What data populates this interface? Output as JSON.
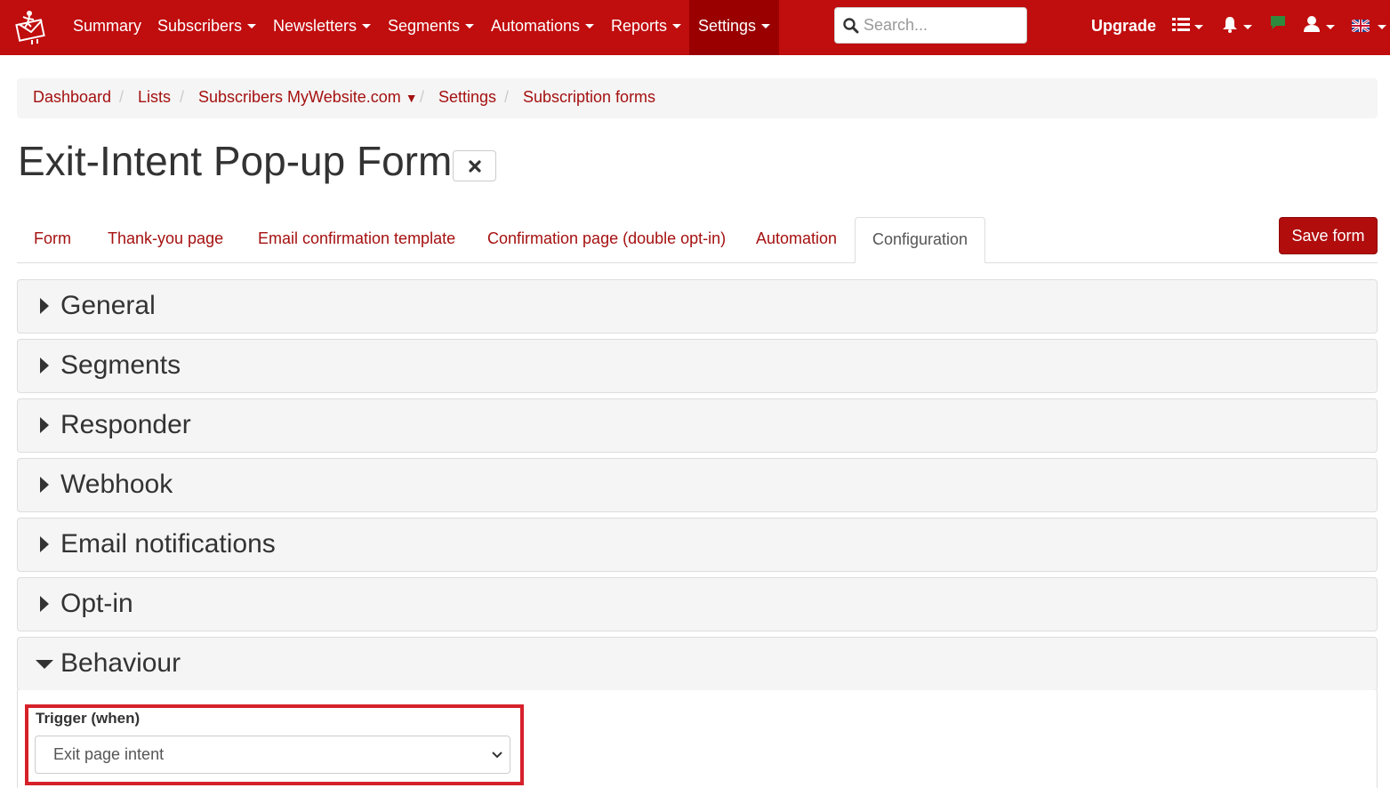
{
  "navbar": {
    "items": [
      {
        "label": "Summary",
        "dropdown": false
      },
      {
        "label": "Subscribers",
        "dropdown": true
      },
      {
        "label": "Newsletters",
        "dropdown": true
      },
      {
        "label": "Segments",
        "dropdown": true
      },
      {
        "label": "Automations",
        "dropdown": true
      },
      {
        "label": "Reports",
        "dropdown": true
      },
      {
        "label": "Settings",
        "dropdown": true,
        "active": true
      }
    ],
    "search_placeholder": "Search...",
    "upgrade_label": "Upgrade",
    "icons": [
      "list-icon",
      "bell-icon",
      "chat-icon",
      "user-icon",
      "uk-flag-icon"
    ],
    "brand_color": "#c00d0e"
  },
  "breadcrumb": {
    "items": [
      "Dashboard",
      "Lists",
      "Subscribers MyWebsite.com",
      "Settings",
      "Subscription forms"
    ],
    "list_dropdown_glyph": "▼"
  },
  "page": {
    "title": "Exit-Intent Pop-up Form"
  },
  "tabs": {
    "items": [
      "Form",
      "Thank-you page",
      "Email confirmation template",
      "Confirmation page (double opt-in)",
      "Automation",
      "Configuration"
    ],
    "active": "Configuration",
    "save_label": "Save form"
  },
  "panels": [
    {
      "title": "General",
      "expanded": false
    },
    {
      "title": "Segments",
      "expanded": false
    },
    {
      "title": "Responder",
      "expanded": false
    },
    {
      "title": "Webhook",
      "expanded": false
    },
    {
      "title": "Email notifications",
      "expanded": false
    },
    {
      "title": "Opt-in",
      "expanded": false
    },
    {
      "title": "Behaviour",
      "expanded": true
    }
  ],
  "behaviour": {
    "trigger_label": "Trigger (when)",
    "trigger_value": "Exit page intent",
    "highlight_color": "#d6212a"
  }
}
